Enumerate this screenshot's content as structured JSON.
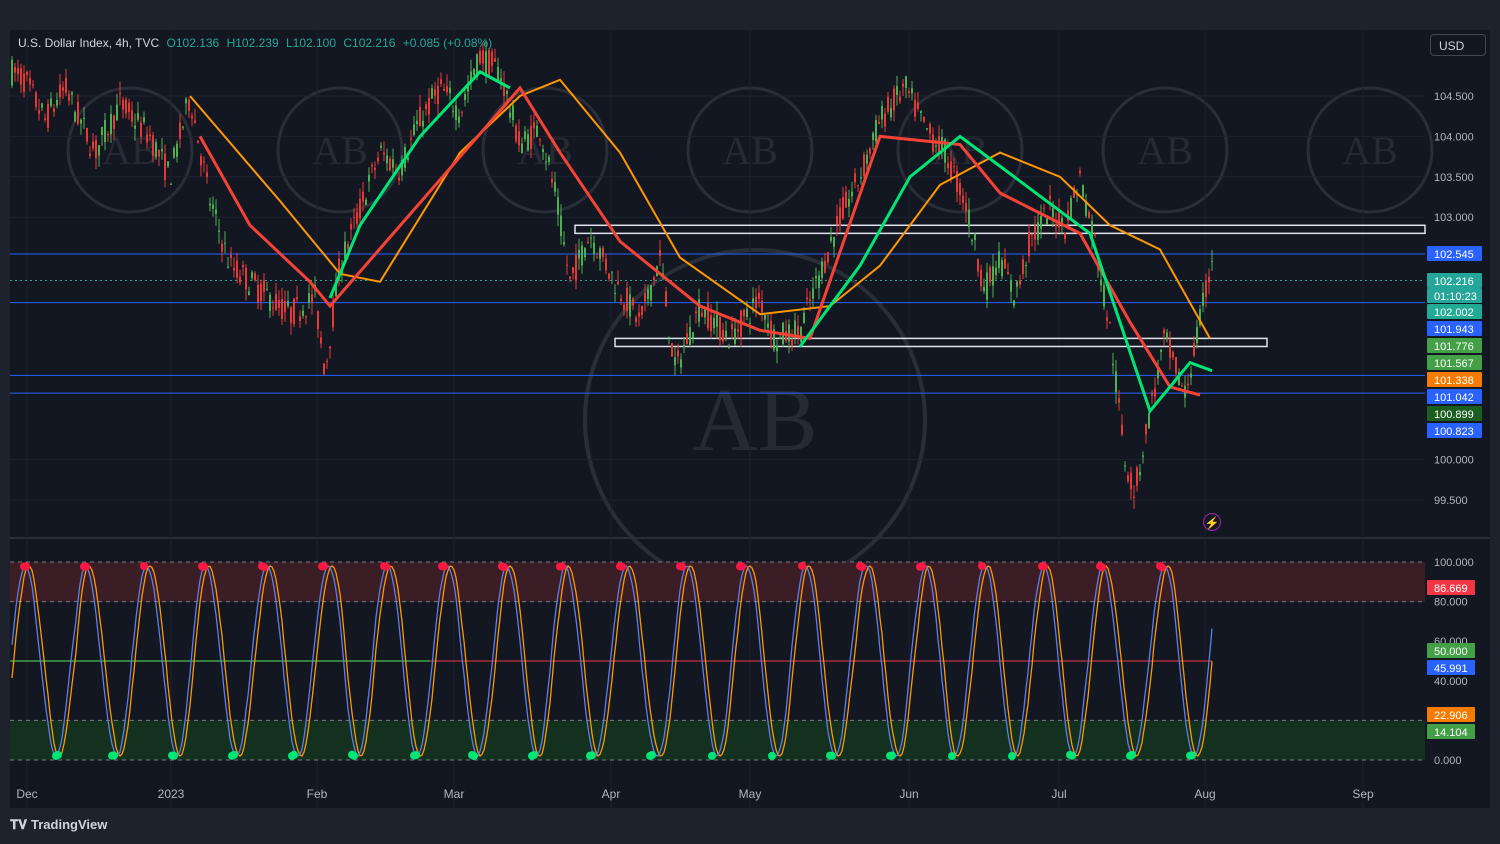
{
  "header": {
    "symbol": "U.S. Dollar Index, 4h, TVC",
    "open": "O102.136",
    "high": "H102.239",
    "low": "L102.100",
    "close": "C102.216",
    "change": "+0.085 (+0.08%)"
  },
  "currency_button": "USD",
  "branding": "TradingView",
  "chart_data": [
    {
      "type": "line",
      "panel": "price",
      "title": "U.S. Dollar Index, 4h, TVC",
      "x_ticks": [
        "Dec",
        "2023",
        "Feb",
        "Mar",
        "Apr",
        "May",
        "Jun",
        "Jul",
        "Aug",
        "Sep"
      ],
      "y_ticks": [
        "104.500",
        "104.000",
        "103.500",
        "103.000",
        "100.000",
        "99.500"
      ],
      "ylim": [
        99.0,
        105.0
      ],
      "price_path": [
        [
          0,
          104.9
        ],
        [
          25,
          104.7
        ],
        [
          45,
          104.2
        ],
        [
          65,
          104.6
        ],
        [
          95,
          103.8
        ],
        [
          120,
          104.4
        ],
        [
          150,
          104.0
        ],
        [
          170,
          103.5
        ],
        [
          190,
          104.5
        ],
        [
          210,
          103.2
        ],
        [
          230,
          102.4
        ],
        [
          260,
          102.1
        ],
        [
          290,
          101.8
        ],
        [
          315,
          102.0
        ],
        [
          325,
          101.1
        ],
        [
          340,
          102.4
        ],
        [
          360,
          103.1
        ],
        [
          380,
          103.8
        ],
        [
          400,
          103.6
        ],
        [
          420,
          104.2
        ],
        [
          440,
          104.6
        ],
        [
          460,
          104.3
        ],
        [
          480,
          105.0
        ],
        [
          500,
          104.8
        ],
        [
          520,
          103.9
        ],
        [
          540,
          104.1
        ],
        [
          555,
          103.3
        ],
        [
          570,
          102.2
        ],
        [
          590,
          102.8
        ],
        [
          615,
          102.2
        ],
        [
          640,
          101.7
        ],
        [
          660,
          102.5
        ],
        [
          675,
          101.1
        ],
        [
          700,
          101.9
        ],
        [
          730,
          101.5
        ],
        [
          760,
          102.0
        ],
        [
          775,
          101.5
        ],
        [
          800,
          101.6
        ],
        [
          820,
          102.3
        ],
        [
          840,
          103.0
        ],
        [
          860,
          103.5
        ],
        [
          880,
          104.2
        ],
        [
          905,
          104.6
        ],
        [
          925,
          104.1
        ],
        [
          945,
          103.8
        ],
        [
          965,
          103.2
        ],
        [
          985,
          102.1
        ],
        [
          1000,
          102.5
        ],
        [
          1015,
          102.0
        ],
        [
          1030,
          102.7
        ],
        [
          1050,
          103.1
        ],
        [
          1065,
          102.9
        ],
        [
          1080,
          103.5
        ],
        [
          1095,
          102.7
        ],
        [
          1110,
          101.6
        ],
        [
          1125,
          100.0
        ],
        [
          1135,
          99.6
        ],
        [
          1150,
          100.6
        ],
        [
          1165,
          101.5
        ],
        [
          1185,
          100.8
        ],
        [
          1200,
          101.7
        ],
        [
          1212,
          102.5
        ],
        [
          1214,
          102.216
        ]
      ],
      "moving_averages": {
        "fast_green": [
          [
            330,
            102.0
          ],
          [
            360,
            102.9
          ],
          [
            420,
            104.0
          ],
          [
            480,
            104.8
          ],
          [
            510,
            104.6
          ]
        ],
        "slow_orange": [
          [
            190,
            104.5
          ],
          [
            280,
            103.2
          ],
          [
            340,
            102.3
          ],
          [
            380,
            102.2
          ],
          [
            460,
            103.8
          ],
          [
            520,
            104.5
          ],
          [
            560,
            104.7
          ],
          [
            620,
            103.8
          ],
          [
            680,
            102.5
          ],
          [
            760,
            101.8
          ],
          [
            830,
            101.9
          ],
          [
            880,
            102.4
          ],
          [
            940,
            103.4
          ],
          [
            1000,
            103.8
          ],
          [
            1060,
            103.5
          ],
          [
            1110,
            102.9
          ],
          [
            1160,
            102.6
          ],
          [
            1210,
            101.5
          ]
        ],
        "red": [
          [
            200,
            104.0
          ],
          [
            250,
            102.9
          ],
          [
            310,
            102.2
          ],
          [
            330,
            101.9
          ],
          [
            520,
            104.6
          ],
          [
            560,
            103.8
          ],
          [
            620,
            102.7
          ],
          [
            700,
            101.9
          ],
          [
            760,
            101.6
          ],
          [
            810,
            101.5
          ],
          [
            880,
            104.0
          ],
          [
            960,
            103.9
          ],
          [
            1000,
            103.3
          ],
          [
            1080,
            102.8
          ],
          [
            1130,
            101.7
          ],
          [
            1170,
            100.9
          ],
          [
            1200,
            100.8
          ]
        ],
        "green_late": [
          [
            800,
            101.4
          ],
          [
            860,
            102.4
          ],
          [
            910,
            103.5
          ],
          [
            960,
            104.0
          ],
          [
            1090,
            102.8
          ],
          [
            1150,
            100.6
          ],
          [
            1190,
            101.2
          ],
          [
            1212,
            101.1
          ]
        ]
      },
      "horizontal_levels": [
        102.545,
        101.943,
        101.042,
        100.823
      ],
      "boxes": [
        {
          "y_top": 102.9,
          "y_bottom": 102.8,
          "x_start": 575,
          "x_end": 1425
        },
        {
          "y_top": 101.5,
          "y_bottom": 101.4,
          "x_start": 615,
          "x_end": 1267
        }
      ],
      "price_labels": [
        {
          "text": "102.545",
          "color": "#2962ff"
        },
        {
          "text": "102.216",
          "color": "#26a69a"
        },
        {
          "text": "01:10:23",
          "color": "#26a69a"
        },
        {
          "text": "102.002",
          "color": "#22ab94"
        },
        {
          "text": "101.943",
          "color": "#2962ff"
        },
        {
          "text": "101.776",
          "color": "#43a047"
        },
        {
          "text": "101.567",
          "color": "#43a047"
        },
        {
          "text": "101.338",
          "color": "#f57c00"
        },
        {
          "text": "101.042",
          "color": "#2962ff"
        },
        {
          "text": "100.899",
          "color": "#1b5e20"
        },
        {
          "text": "100.823",
          "color": "#2962ff"
        }
      ]
    },
    {
      "type": "line",
      "panel": "oscillator",
      "y_ticks": [
        "100.000",
        "80.000",
        "60.000",
        "40.000",
        "0.000"
      ],
      "ylim": [
        0,
        100
      ],
      "levels": [
        100,
        80,
        20,
        0
      ],
      "midline": 50,
      "last_value": 22.906,
      "value_labels": [
        {
          "text": "86.669",
          "color": "#f23645"
        },
        {
          "text": "50.000",
          "color": "#43a047"
        },
        {
          "text": "45.991",
          "color": "#2962ff"
        },
        {
          "text": "22.906",
          "color": "#f57c00"
        },
        {
          "text": "14.104",
          "color": "#43a047"
        }
      ]
    }
  ],
  "colors": {
    "background": "#131722",
    "frame": "#1e222d",
    "bull": "#26a69a",
    "bear": "#f23645",
    "level_blue": "#2962ff"
  },
  "icons": [
    "alert-bolt-icon",
    "tradingview-logo-icon"
  ]
}
